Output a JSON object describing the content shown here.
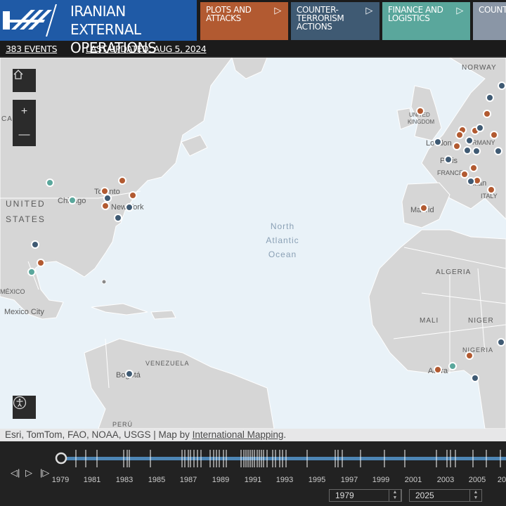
{
  "header": {
    "title_line1": "IRANIAN EXTERNAL",
    "title_line2": "OPERATIONS",
    "event_count": "383 EVENTS",
    "last_updated": "LAST UPDATED: AUG 5, 2024"
  },
  "categories": [
    {
      "label": "PLOTS AND ATTACKS",
      "color": "#b25a31"
    },
    {
      "label": "COUNTER-TERRORISM ACTIONS",
      "color": "#3f5a73"
    },
    {
      "label": "FINANCE AND LOGISTICS",
      "color": "#5aa79c"
    },
    {
      "label": "COUNTR",
      "color": "#8a96a6"
    }
  ],
  "icons": {
    "home": "home-icon",
    "zoom_in": "plus-icon",
    "zoom_out": "minus-icon",
    "accessibility": "accessibility-icon",
    "prev": "step-back-icon",
    "play": "play-icon",
    "next": "step-forward-icon"
  },
  "map": {
    "ocean_label_1": "North",
    "ocean_label_2": "Atlantic",
    "ocean_label_3": "Ocean",
    "place_labels": [
      "NORWAY",
      "UNITED",
      "KINGDOM",
      "London",
      "RMANY",
      "Paris",
      "FRANCE",
      "Milan",
      "ITALY",
      "Madrid",
      "ALGERIA",
      "MALI",
      "NIGER",
      "NIGERIA",
      "Accra",
      "CA",
      "UNITED",
      "STATES",
      "Toronto",
      "Chicago",
      "New York",
      "MÉXICO",
      "Mexico City",
      "VENEZUELA",
      "Bogotá",
      "PERÚ"
    ],
    "attribution": "Esri, TomTom, FAO, NOAA, USGS | Map by ",
    "attribution_link": "International Mapping",
    "attribution_end": "."
  },
  "timeline": {
    "years": [
      "1979",
      "1981",
      "1983",
      "1985",
      "1987",
      "1989",
      "1991",
      "1993",
      "1995",
      "1997",
      "1999",
      "2001",
      "2003",
      "2005",
      "20"
    ],
    "start_year": "1979",
    "end_year": "2025"
  }
}
